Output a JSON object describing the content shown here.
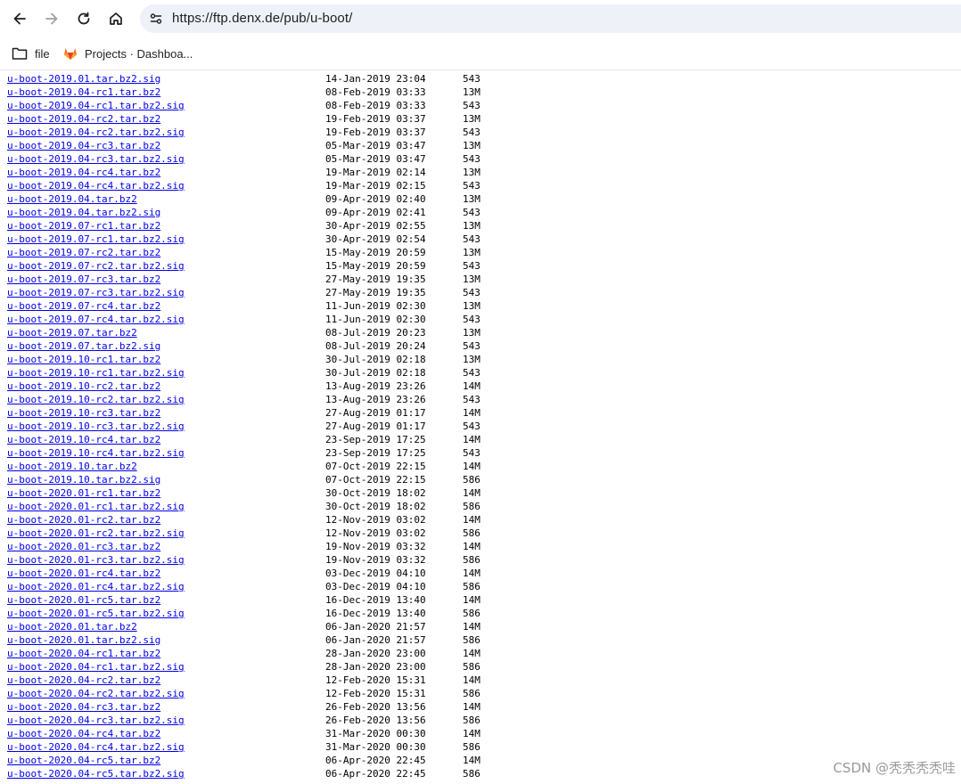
{
  "browser": {
    "url": "https://ftp.denx.de/pub/u-boot/",
    "bookmarks": [
      {
        "label": "file",
        "icon": "folder-icon"
      },
      {
        "label": "Projects · Dashboa...",
        "icon": "gitlab-icon"
      }
    ]
  },
  "listing": {
    "rows": [
      {
        "name": "u-boot-2019.01.tar.bz2.sig",
        "date": "14-Jan-2019 23:04",
        "size": "543"
      },
      {
        "name": "u-boot-2019.04-rc1.tar.bz2",
        "date": "08-Feb-2019 03:33",
        "size": "13M"
      },
      {
        "name": "u-boot-2019.04-rc1.tar.bz2.sig",
        "date": "08-Feb-2019 03:33",
        "size": "543"
      },
      {
        "name": "u-boot-2019.04-rc2.tar.bz2",
        "date": "19-Feb-2019 03:37",
        "size": "13M"
      },
      {
        "name": "u-boot-2019.04-rc2.tar.bz2.sig",
        "date": "19-Feb-2019 03:37",
        "size": "543"
      },
      {
        "name": "u-boot-2019.04-rc3.tar.bz2",
        "date": "05-Mar-2019 03:47",
        "size": "13M"
      },
      {
        "name": "u-boot-2019.04-rc3.tar.bz2.sig",
        "date": "05-Mar-2019 03:47",
        "size": "543"
      },
      {
        "name": "u-boot-2019.04-rc4.tar.bz2",
        "date": "19-Mar-2019 02:14",
        "size": "13M"
      },
      {
        "name": "u-boot-2019.04-rc4.tar.bz2.sig",
        "date": "19-Mar-2019 02:15",
        "size": "543"
      },
      {
        "name": "u-boot-2019.04.tar.bz2",
        "date": "09-Apr-2019 02:40",
        "size": "13M"
      },
      {
        "name": "u-boot-2019.04.tar.bz2.sig",
        "date": "09-Apr-2019 02:41",
        "size": "543"
      },
      {
        "name": "u-boot-2019.07-rc1.tar.bz2",
        "date": "30-Apr-2019 02:55",
        "size": "13M"
      },
      {
        "name": "u-boot-2019.07-rc1.tar.bz2.sig",
        "date": "30-Apr-2019 02:54",
        "size": "543"
      },
      {
        "name": "u-boot-2019.07-rc2.tar.bz2",
        "date": "15-May-2019 20:59",
        "size": "13M"
      },
      {
        "name": "u-boot-2019.07-rc2.tar.bz2.sig",
        "date": "15-May-2019 20:59",
        "size": "543"
      },
      {
        "name": "u-boot-2019.07-rc3.tar.bz2",
        "date": "27-May-2019 19:35",
        "size": "13M"
      },
      {
        "name": "u-boot-2019.07-rc3.tar.bz2.sig",
        "date": "27-May-2019 19:35",
        "size": "543"
      },
      {
        "name": "u-boot-2019.07-rc4.tar.bz2",
        "date": "11-Jun-2019 02:30",
        "size": "13M"
      },
      {
        "name": "u-boot-2019.07-rc4.tar.bz2.sig",
        "date": "11-Jun-2019 02:30",
        "size": "543"
      },
      {
        "name": "u-boot-2019.07.tar.bz2",
        "date": "08-Jul-2019 20:23",
        "size": "13M"
      },
      {
        "name": "u-boot-2019.07.tar.bz2.sig",
        "date": "08-Jul-2019 20:24",
        "size": "543"
      },
      {
        "name": "u-boot-2019.10-rc1.tar.bz2",
        "date": "30-Jul-2019 02:18",
        "size": "13M"
      },
      {
        "name": "u-boot-2019.10-rc1.tar.bz2.sig",
        "date": "30-Jul-2019 02:18",
        "size": "543"
      },
      {
        "name": "u-boot-2019.10-rc2.tar.bz2",
        "date": "13-Aug-2019 23:26",
        "size": "14M"
      },
      {
        "name": "u-boot-2019.10-rc2.tar.bz2.sig",
        "date": "13-Aug-2019 23:26",
        "size": "543"
      },
      {
        "name": "u-boot-2019.10-rc3.tar.bz2",
        "date": "27-Aug-2019 01:17",
        "size": "14M"
      },
      {
        "name": "u-boot-2019.10-rc3.tar.bz2.sig",
        "date": "27-Aug-2019 01:17",
        "size": "543"
      },
      {
        "name": "u-boot-2019.10-rc4.tar.bz2",
        "date": "23-Sep-2019 17:25",
        "size": "14M"
      },
      {
        "name": "u-boot-2019.10-rc4.tar.bz2.sig",
        "date": "23-Sep-2019 17:25",
        "size": "543"
      },
      {
        "name": "u-boot-2019.10.tar.bz2",
        "date": "07-Oct-2019 22:15",
        "size": "14M"
      },
      {
        "name": "u-boot-2019.10.tar.bz2.sig",
        "date": "07-Oct-2019 22:15",
        "size": "586"
      },
      {
        "name": "u-boot-2020.01-rc1.tar.bz2",
        "date": "30-Oct-2019 18:02",
        "size": "14M"
      },
      {
        "name": "u-boot-2020.01-rc1.tar.bz2.sig",
        "date": "30-Oct-2019 18:02",
        "size": "586"
      },
      {
        "name": "u-boot-2020.01-rc2.tar.bz2",
        "date": "12-Nov-2019 03:02",
        "size": "14M"
      },
      {
        "name": "u-boot-2020.01-rc2.tar.bz2.sig",
        "date": "12-Nov-2019 03:02",
        "size": "586"
      },
      {
        "name": "u-boot-2020.01-rc3.tar.bz2",
        "date": "19-Nov-2019 03:32",
        "size": "14M"
      },
      {
        "name": "u-boot-2020.01-rc3.tar.bz2.sig",
        "date": "19-Nov-2019 03:32",
        "size": "586"
      },
      {
        "name": "u-boot-2020.01-rc4.tar.bz2",
        "date": "03-Dec-2019 04:10",
        "size": "14M"
      },
      {
        "name": "u-boot-2020.01-rc4.tar.bz2.sig",
        "date": "03-Dec-2019 04:10",
        "size": "586"
      },
      {
        "name": "u-boot-2020.01-rc5.tar.bz2",
        "date": "16-Dec-2019 13:40",
        "size": "14M"
      },
      {
        "name": "u-boot-2020.01-rc5.tar.bz2.sig",
        "date": "16-Dec-2019 13:40",
        "size": "586"
      },
      {
        "name": "u-boot-2020.01.tar.bz2",
        "date": "06-Jan-2020 21:57",
        "size": "14M"
      },
      {
        "name": "u-boot-2020.01.tar.bz2.sig",
        "date": "06-Jan-2020 21:57",
        "size": "586"
      },
      {
        "name": "u-boot-2020.04-rc1.tar.bz2",
        "date": "28-Jan-2020 23:00",
        "size": "14M"
      },
      {
        "name": "u-boot-2020.04-rc1.tar.bz2.sig",
        "date": "28-Jan-2020 23:00",
        "size": "586"
      },
      {
        "name": "u-boot-2020.04-rc2.tar.bz2",
        "date": "12-Feb-2020 15:31",
        "size": "14M"
      },
      {
        "name": "u-boot-2020.04-rc2.tar.bz2.sig",
        "date": "12-Feb-2020 15:31",
        "size": "586"
      },
      {
        "name": "u-boot-2020.04-rc3.tar.bz2",
        "date": "26-Feb-2020 13:56",
        "size": "14M"
      },
      {
        "name": "u-boot-2020.04-rc3.tar.bz2.sig",
        "date": "26-Feb-2020 13:56",
        "size": "586"
      },
      {
        "name": "u-boot-2020.04-rc4.tar.bz2",
        "date": "31-Mar-2020 00:30",
        "size": "14M"
      },
      {
        "name": "u-boot-2020.04-rc4.tar.bz2.sig",
        "date": "31-Mar-2020 00:30",
        "size": "586"
      },
      {
        "name": "u-boot-2020.04-rc5.tar.bz2",
        "date": "06-Apr-2020 22:45",
        "size": "14M"
      },
      {
        "name": "u-boot-2020.04-rc5.tar.bz2.sig",
        "date": "06-Apr-2020 22:45",
        "size": "586"
      }
    ]
  },
  "watermark": "CSDN @秃秃秃秃哇"
}
